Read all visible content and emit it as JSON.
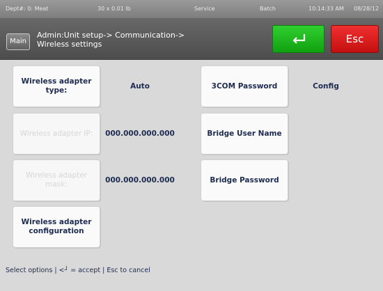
{
  "status_bar": {
    "dept": "Dept#: 0: Meat",
    "weight": "30 x 0.01 lb",
    "mode": "Service",
    "batch": "Batch",
    "time": "10:14:33 AM",
    "date": "08/28/12"
  },
  "header": {
    "main_label": "Main",
    "breadcrumb_line1": "Admin:Unit setup-> Communication->",
    "breadcrumb_line2": "Wireless settings",
    "enter_icon": "enter-arrow-icon",
    "esc_label": "Esc"
  },
  "settings": {
    "wireless_adapter_type_label": "Wireless adapter type:",
    "wireless_adapter_type_value": "Auto",
    "wireless_adapter_ip_label": "Wireless adapter IP:",
    "wireless_adapter_ip_value": "000.000.000.000",
    "wireless_adapter_mask_label": "Wireless adapter mask:",
    "wireless_adapter_mask_value": "000.000.000.000",
    "wireless_adapter_config_label": "Wireless adapter configuration",
    "three_com_password_label": "3COM Password",
    "three_com_password_value": "Config",
    "bridge_user_name_label": "Bridge User Name",
    "bridge_password_label": "Bridge Password"
  },
  "footer": {
    "hint": "Select options | <┘ = accept | Esc to cancel"
  },
  "colors": {
    "accept_button": "#18b018",
    "escape_button": "#e01a1a",
    "text_primary": "#1c2b4f",
    "background": "#d9d9d9"
  }
}
